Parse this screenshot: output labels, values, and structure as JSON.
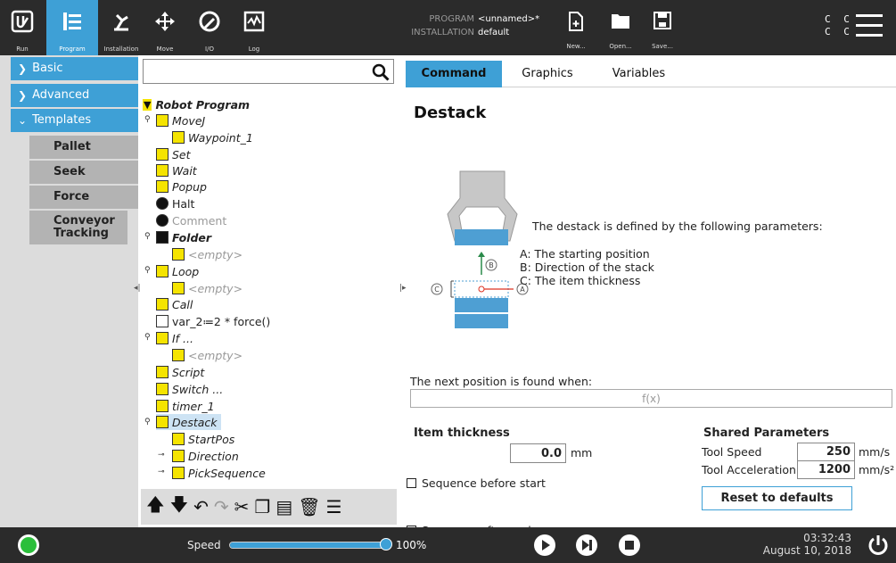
{
  "topbar": {
    "nav": [
      {
        "label": "Run",
        "icon": "ur-logo-icon"
      },
      {
        "label": "Program",
        "icon": "program-tree-icon"
      },
      {
        "label": "Installation",
        "icon": "installation-icon"
      },
      {
        "label": "Move",
        "icon": "move-arrows-icon"
      },
      {
        "label": "I/O",
        "icon": "io-icon"
      },
      {
        "label": "Log",
        "icon": "log-icon"
      }
    ],
    "program_key": "PROGRAM",
    "program_value": "<unnamed>*",
    "installation_key": "INSTALLATION",
    "installation_value": "default",
    "file_buttons": [
      {
        "label": "New...",
        "icon": "new-file-icon"
      },
      {
        "label": "Open...",
        "icon": "folder-icon"
      },
      {
        "label": "Save...",
        "icon": "save-icon"
      }
    ],
    "cc_row1": "C C",
    "cc_row2": "C C"
  },
  "leftnav": {
    "items": [
      {
        "label": "Basic",
        "chevron": "chevron-right-icon"
      },
      {
        "label": "Advanced",
        "chevron": "chevron-right-icon"
      },
      {
        "label": "Templates",
        "chevron": "chevron-down-icon"
      }
    ],
    "templates": [
      "Pallet",
      "Seek",
      "Force",
      "Conveyor Tracking"
    ]
  },
  "tree": {
    "root": "Robot Program",
    "rows": [
      {
        "text": "MoveJ"
      },
      {
        "text": "Waypoint_1"
      },
      {
        "text": "Set"
      },
      {
        "text": "Wait"
      },
      {
        "text": "Popup"
      },
      {
        "text": "Halt"
      },
      {
        "text": "Comment"
      },
      {
        "text": "Folder"
      },
      {
        "text": "<empty>"
      },
      {
        "text": "Loop"
      },
      {
        "text": "<empty>"
      },
      {
        "text": "Call"
      },
      {
        "text": "var_2≔2 * force()"
      },
      {
        "text": "If ..."
      },
      {
        "text": "<empty>"
      },
      {
        "text": "Script"
      },
      {
        "text": "Switch ..."
      },
      {
        "text": "timer_1"
      },
      {
        "text": "Destack"
      },
      {
        "text": "StartPos"
      },
      {
        "text": "Direction"
      },
      {
        "text": "PickSequence"
      }
    ]
  },
  "tabs": [
    "Command",
    "Graphics",
    "Variables"
  ],
  "destack": {
    "title": "Destack",
    "intro": "The destack is defined by the following parameters:",
    "param_a": "A: The starting position",
    "param_b": "B: Direction of the stack",
    "param_c": "C: The item thickness",
    "label_a": "A",
    "label_b": "B",
    "label_c": "C",
    "next_label": "The next position is found when:",
    "fx": "f(x)",
    "thickness_label": "Item thickness",
    "thickness_value": "0.0",
    "thickness_unit": "mm",
    "seq_before": "Sequence before start",
    "seq_after": "Sequence after end",
    "shared_title": "Shared Parameters",
    "tool_speed_label": "Tool Speed",
    "tool_speed_value": "250",
    "tool_speed_unit": "mm/s",
    "tool_acc_label": "Tool Acceleration",
    "tool_acc_value": "1200",
    "tool_acc_unit": "mm/s²",
    "reset": "Reset to defaults"
  },
  "bottombar": {
    "speed_label": "Speed",
    "speed_pct": "100%",
    "speed_fraction": 1.0,
    "time": "03:32:43",
    "date": "August 10, 2018"
  },
  "colors": {
    "accent": "#3ea0d6",
    "dark": "#2b2b2b",
    "yellow": "#f5e400",
    "go": "#2bbf3b"
  }
}
